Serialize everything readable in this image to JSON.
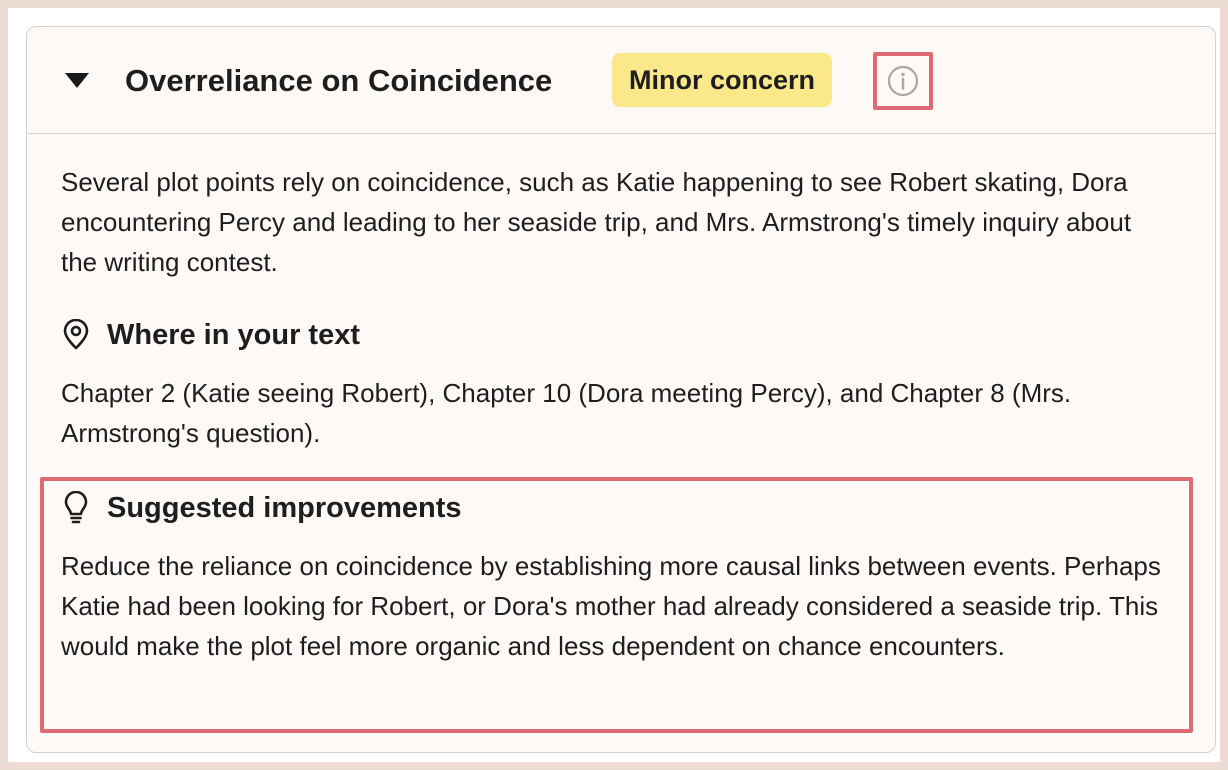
{
  "issue": {
    "title": "Overreliance on Coincidence",
    "severity_badge": "Minor concern",
    "description": "Several plot points rely on coincidence, such as Katie happening to see Robert skating, Dora encountering Percy and leading to her seaside trip, and Mrs. Armstrong's timely inquiry about the writing contest.",
    "location": {
      "heading": "Where in your text",
      "icon": "map-pin-icon",
      "text": "Chapter 2 (Katie seeing Robert), Chapter 10 (Dora meeting Percy), and Chapter 8 (Mrs. Armstrong's question)."
    },
    "suggestions": {
      "heading": "Suggested improvements",
      "icon": "lightbulb-icon",
      "text": "Reduce the reliance on coincidence by establishing more causal links between events. Perhaps Katie had been looking for Robert, or Dora's mother had already considered a seaside trip. This would make the plot feel more organic and less dependent on chance encounters."
    }
  },
  "colors": {
    "badge_background": "#fbe88a",
    "highlight_border": "#de6b73",
    "card_background": "#fdf9f7",
    "page_background": "#ecdcd3"
  }
}
